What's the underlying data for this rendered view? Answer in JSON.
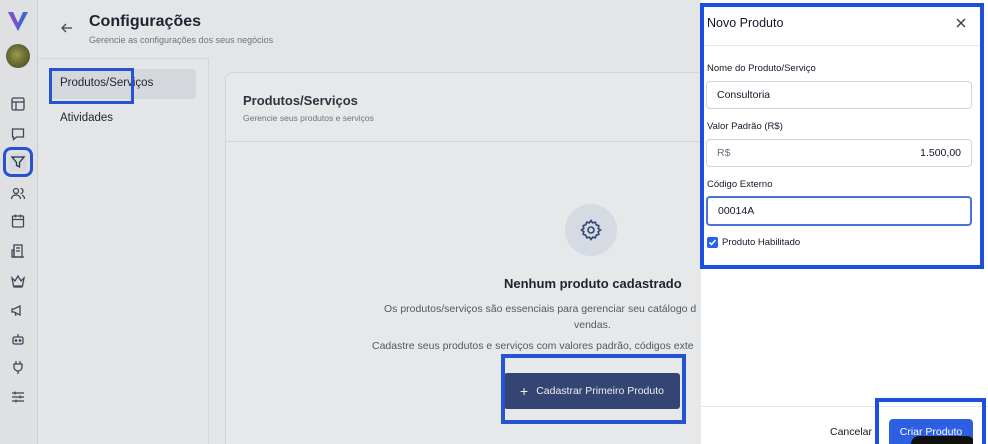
{
  "header": {
    "title": "Configurações",
    "subtitle": "Gerencie as configurações dos seus negócios"
  },
  "settings_nav": {
    "items": [
      {
        "label": "Produtos/Serviços",
        "active": true
      },
      {
        "label": "Atividades",
        "active": false
      }
    ]
  },
  "card": {
    "title": "Produtos/Serviços",
    "subtitle": "Gerencie seus produtos e serviços",
    "empty_title": "Nenhum produto cadastrado",
    "empty_desc_line1": "Os produtos/serviços são essenciais para gerenciar seu catálogo d",
    "empty_desc_line2": "vendas.",
    "empty_desc_line3": "Cadastre seus produtos e serviços com valores padrão, códigos exte",
    "cta_label": "Cadastrar Primeiro Produto"
  },
  "drawer": {
    "title": "Novo Produto",
    "name_label": "Nome do Produto/Serviço",
    "name_value": "Consultoria",
    "price_label": "Valor Padrão (R$)",
    "price_prefix": "R$",
    "price_value": "1.500,00",
    "code_label": "Código Externo",
    "code_value": "00014A",
    "enabled_label": "Produto Habilitado",
    "enabled": true,
    "cancel_label": "Cancelar",
    "create_label": "Criar Produto"
  },
  "colors": {
    "accent_blue": "#2d5fe3",
    "highlight_box": "#1a4fe0",
    "cta_bg": "#2b3e72"
  },
  "rail_icons": [
    "logo-icon",
    "avatar",
    "layout-icon",
    "chat-icon",
    "filter-icon",
    "users-icon",
    "calendar-icon",
    "building-icon",
    "crown-icon",
    "megaphone-icon",
    "bot-icon",
    "plug-icon",
    "sliders-icon"
  ]
}
